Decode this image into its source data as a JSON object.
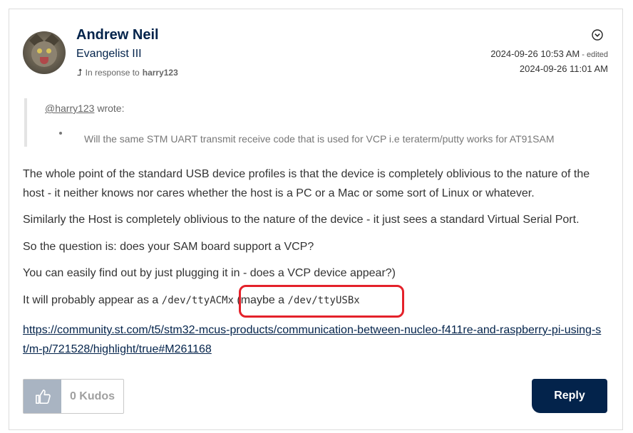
{
  "author": {
    "name": "Andrew Neil",
    "rank": "Evangelist III",
    "in_response_prefix": "In response to",
    "in_response_to": "harry123"
  },
  "dates": {
    "posted": "2024-09-26 10:53 AM",
    "edited_label": " - edited",
    "edited": "2024-09-26 11:01 AM"
  },
  "quote": {
    "mention": "@harry123",
    "wrote": " wrote:",
    "bullet": "Will the same STM UART transmit receive code that is used for VCP  i.e teraterm/putty works for AT91SAM"
  },
  "body": {
    "p1_line1": "The whole point of the standard USB device profiles is that the device is completely oblivious to the nature of the",
    "p1_line2": "host - it neither knows nor cares whether the host is a PC or a Mac or some  sort of Linux or whatever.",
    "p2": "Similarly the Host is completely oblivious to the nature of the device - it just sees a standard Virtual Serial Port.",
    "p3": "So the question is: does your SAM board support a VCP?",
    "p4": "You can easily find out by just plugging it in - does a VCP device appear?)",
    "p5_prefix": "It will probably appear as a ",
    "p5_code1": "/dev/ttyACMx",
    "p5_middle": " (maybe a ",
    "p5_code2": "/dev/ttyUSBx",
    "link": "https://community.st.com/t5/stm32-mcus-products/communication-between-nucleo-f411re-and-raspberry-pi-using-st/m-p/721528/highlight/true#M261168"
  },
  "actions": {
    "kudos_label": "0 Kudos",
    "reply_label": "Reply"
  },
  "colors": {
    "brand_navy": "#03234b",
    "highlight_red": "#e4212a",
    "kudos_thumb_bg": "#a9b4c2"
  }
}
